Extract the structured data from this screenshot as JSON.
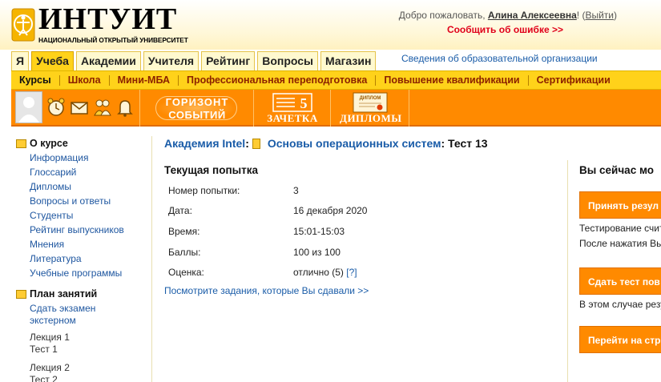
{
  "header": {
    "logo_title": "ИНТУИТ",
    "logo_subtitle": "НАЦИОНАЛЬНЫЙ ОТКРЫТЫЙ УНИВЕРСИТЕТ",
    "welcome_prefix": "Добро пожаловать, ",
    "user_name": "Алина Алексеевна",
    "welcome_excl": "!",
    "logout_open": " (",
    "logout_label": "Выйти",
    "logout_close": ")",
    "report_error": "Сообщить об ошибке >>"
  },
  "top_tabs": [
    "Я",
    "Учеба",
    "Академии",
    "Учителя",
    "Рейтинг",
    "Вопросы",
    "Магазин"
  ],
  "org_info": "Сведения об образовательной организации",
  "subnav": [
    "Курсы",
    "Школа",
    "Мини-МБА",
    "Профессиональная переподготовка",
    "Повышение квалификации",
    "Сертификации"
  ],
  "toolbar": {
    "horizon_line1": "ГОРИЗОНТ",
    "horizon_line2": "СОБЫТИЙ",
    "zachetka_label": "ЗАЧЕТКА",
    "zachetka_number": "5",
    "diplomas_label": "ДИПЛОМЫ",
    "diploma_card_text": "ДИПЛОМ"
  },
  "sidebar": {
    "about_title": "О курсе",
    "about_links": [
      "Информация",
      "Глоссарий",
      "Дипломы",
      "Вопросы и ответы",
      "Студенты",
      "Рейтинг выпускников",
      "Мнения",
      "Литература",
      "Учебные программы"
    ],
    "plan_title": "План занятий",
    "plan_exam_line1": "Сдать экзамен",
    "plan_exam_line2": "экстерном",
    "lectures": [
      {
        "title": "Лекция 1",
        "sub": "Тест 1"
      },
      {
        "title": "Лекция 2",
        "sub": "Тест 2"
      }
    ]
  },
  "breadcrumb": {
    "academy": "Академия Intel",
    "colon": ":",
    "course": "Основы операционных систем",
    "test": ": Тест 13"
  },
  "attempt": {
    "title": "Текущая попытка",
    "rows": [
      {
        "label": "Номер попытки:",
        "value": "3"
      },
      {
        "label": "Дата:",
        "value": "16 декабря 2020"
      },
      {
        "label": "Время:",
        "value": "15:01-15:03"
      },
      {
        "label": "Баллы:",
        "value": "100 из 100"
      },
      {
        "label": "Оценка:",
        "value": "отлично (5) "
      }
    ],
    "help_link": "[?]",
    "view_tasks": "Посмотрите задания, которые Вы сдавали >>"
  },
  "right_panel": {
    "title": "Вы сейчас мо",
    "accept_button": "Принять резул",
    "text1": "Тестирование счит",
    "text2": "После нажатия Вы",
    "retake_button": "Сдать тест пов",
    "text3": "В этом случае резу",
    "next_button": "Перейти на стр"
  },
  "colors": {
    "accent_orange": "#ff8a00",
    "tab_yellow": "#ffd21a",
    "link_blue": "#1a5ca8",
    "error_red": "#e0001a"
  }
}
